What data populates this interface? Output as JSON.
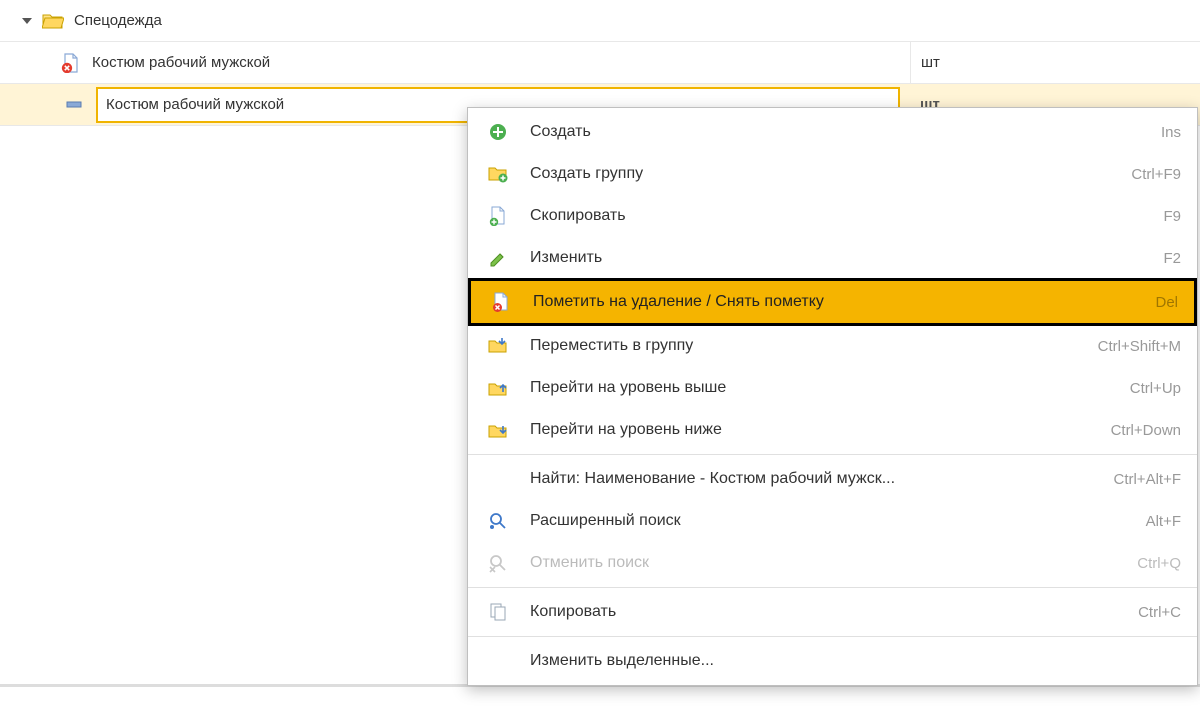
{
  "tree": {
    "group_label": "Спецодежда",
    "item1_label": "Костюм рабочий мужской",
    "item1_unit": "шт",
    "item2_label": "Костюм рабочий мужской",
    "item2_unit": "шт"
  },
  "menu": {
    "create": {
      "label": "Создать",
      "shortcut": "Ins"
    },
    "create_group": {
      "label": "Создать группу",
      "shortcut": "Ctrl+F9"
    },
    "copy": {
      "label": "Скопировать",
      "shortcut": "F9"
    },
    "edit": {
      "label": "Изменить",
      "shortcut": "F2"
    },
    "mark_delete": {
      "label": "Пометить на удаление / Снять пометку",
      "shortcut": "Del"
    },
    "move_group": {
      "label": "Переместить в группу",
      "shortcut": "Ctrl+Shift+M"
    },
    "level_up": {
      "label": "Перейти на уровень выше",
      "shortcut": "Ctrl+Up"
    },
    "level_down": {
      "label": "Перейти на уровень ниже",
      "shortcut": "Ctrl+Down"
    },
    "find": {
      "label": "Найти: Наименование - Костюм рабочий мужск...",
      "shortcut": "Ctrl+Alt+F"
    },
    "adv_find": {
      "label": "Расширенный поиск",
      "shortcut": "Alt+F"
    },
    "cancel_find": {
      "label": "Отменить поиск",
      "shortcut": "Ctrl+Q"
    },
    "clipboard_copy": {
      "label": "Копировать",
      "shortcut": "Ctrl+C"
    },
    "edit_selected": {
      "label": "Изменить выделенные...",
      "shortcut": ""
    }
  }
}
